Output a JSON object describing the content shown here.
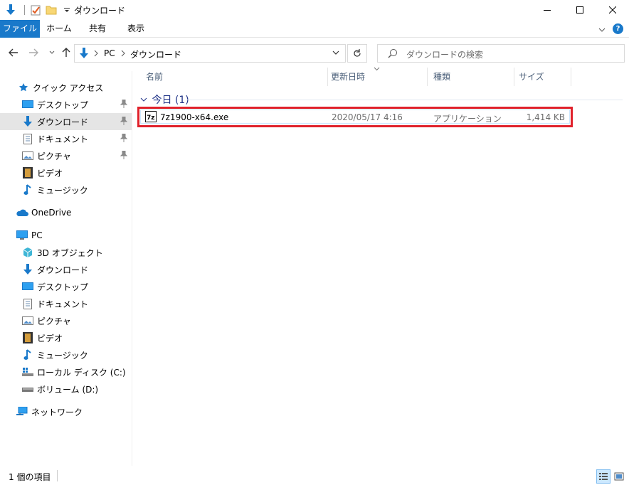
{
  "window": {
    "title": "ダウンロード"
  },
  "ribbon": {
    "tabs": [
      "ファイル",
      "ホーム",
      "共有",
      "表示"
    ]
  },
  "address": {
    "crumbs": [
      "PC",
      "ダウンロード"
    ]
  },
  "search": {
    "placeholder": "ダウンロードの検索"
  },
  "sidebar": {
    "quick_access": "クイック アクセス",
    "quick_items": [
      "デスクトップ",
      "ダウンロード",
      "ドキュメント",
      "ピクチャ",
      "ビデオ",
      "ミュージック"
    ],
    "onedrive": "OneDrive",
    "pc": "PC",
    "pc_items": [
      "3D オブジェクト",
      "ダウンロード",
      "デスクトップ",
      "ドキュメント",
      "ピクチャ",
      "ビデオ",
      "ミュージック",
      "ローカル ディスク (C:)",
      "ボリューム (D:)"
    ],
    "network": "ネットワーク"
  },
  "columns": [
    "名前",
    "更新日時",
    "種類",
    "サイズ"
  ],
  "group": {
    "label": "今日 (1)"
  },
  "files": [
    {
      "name": "7z1900-x64.exe",
      "modified": "2020/05/17 4:16",
      "type": "アプリケーション",
      "size": "1,414 KB"
    }
  ],
  "status": {
    "count": "1 個の項目"
  },
  "colors": {
    "accent": "#1979ca",
    "highlight": "#e0212b",
    "group": "#1e3287"
  }
}
